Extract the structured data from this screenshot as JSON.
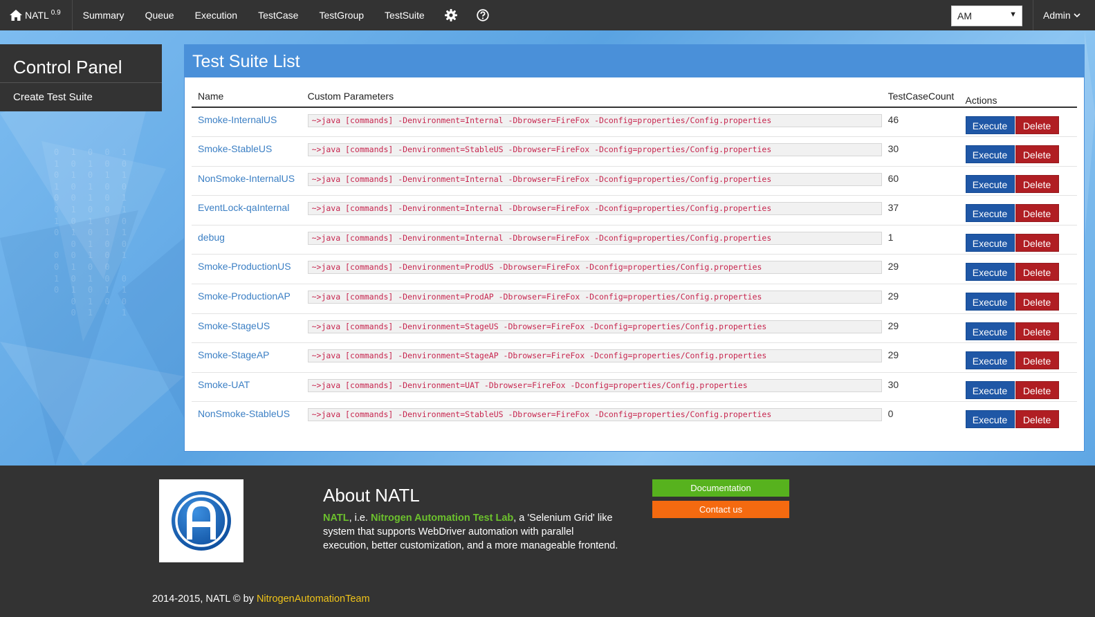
{
  "nav": {
    "brand": "NATL",
    "version": "0.9",
    "links": [
      "Summary",
      "Queue",
      "Execution",
      "TestCase",
      "TestGroup",
      "TestSuite"
    ],
    "env_selected": "AM",
    "user": "Admin"
  },
  "sidebar": {
    "title": "Control Panel",
    "items": [
      "Create Test Suite"
    ]
  },
  "main": {
    "title": "Test Suite List",
    "columns": [
      "Name",
      "Custom Parameters",
      "TestCaseCount",
      "Actions"
    ],
    "execute_label": "Execute",
    "delete_label": "Delete",
    "rows": [
      {
        "name": "Smoke-InternalUS",
        "params": "~>java [commands] -Denvironment=Internal -Dbrowser=FireFox -Dconfig=properties/Config.properties",
        "count": "46"
      },
      {
        "name": "Smoke-StableUS",
        "params": "~>java [commands] -Denvironment=StableUS -Dbrowser=FireFox -Dconfig=properties/Config.properties",
        "count": "30"
      },
      {
        "name": "NonSmoke-InternalUS",
        "params": "~>java [commands] -Denvironment=Internal -Dbrowser=FireFox -Dconfig=properties/Config.properties",
        "count": "60"
      },
      {
        "name": "EventLock-qaInternal",
        "params": "~>java [commands] -Denvironment=Internal -Dbrowser=FireFox -Dconfig=properties/Config.properties",
        "count": "37"
      },
      {
        "name": "debug",
        "params": "~>java [commands] -Denvironment=Internal -Dbrowser=FireFox -Dconfig=properties/Config.properties",
        "count": "1"
      },
      {
        "name": "Smoke-ProductionUS",
        "params": "~>java [commands] -Denvironment=ProdUS -Dbrowser=FireFox -Dconfig=properties/Config.properties",
        "count": "29"
      },
      {
        "name": "Smoke-ProductionAP",
        "params": "~>java [commands] -Denvironment=ProdAP -Dbrowser=FireFox -Dconfig=properties/Config.properties",
        "count": "29"
      },
      {
        "name": "Smoke-StageUS",
        "params": "~>java [commands] -Denvironment=StageUS -Dbrowser=FireFox -Dconfig=properties/Config.properties",
        "count": "29"
      },
      {
        "name": "Smoke-StageAP",
        "params": "~>java [commands] -Denvironment=StageAP -Dbrowser=FireFox -Dconfig=properties/Config.properties",
        "count": "29"
      },
      {
        "name": "Smoke-UAT",
        "params": "~>java [commands] -Denvironment=UAT -Dbrowser=FireFox -Dconfig=properties/Config.properties",
        "count": "30"
      },
      {
        "name": "NonSmoke-StableUS",
        "params": "~>java [commands] -Denvironment=StableUS -Dbrowser=FireFox -Dconfig=properties/Config.properties",
        "count": "0"
      }
    ]
  },
  "footer": {
    "about_title": "About NATL",
    "about_natl": "NATL",
    "about_ie": ", i.e. ",
    "about_fullname": "Nitrogen Automation Test Lab",
    "about_rest": ", a 'Selenium Grid' like system that supports WebDriver automation with parallel execution, better customization, and a more manageable frontend.",
    "doc_button": "Documentation",
    "contact_button": "Contact us",
    "copyright": "2014-2015, NATL © by ",
    "team": "NitrogenAutomationTeam"
  },
  "colors": {
    "navbar": "#333333",
    "accent_blue": "#4a90d9",
    "execute": "#1f57a6",
    "delete": "#b01e23",
    "doc_green": "#57b21e",
    "contact_orange": "#f46a10",
    "highlight_green": "#6cc12d",
    "team_yellow": "#f0c419"
  },
  "icons": [
    "home-icon",
    "gear-icon",
    "help-icon",
    "chevron-down-icon",
    "natl-logo"
  ]
}
